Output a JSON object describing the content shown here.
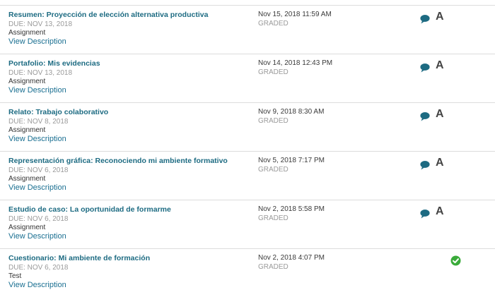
{
  "rows": [
    {
      "title": "Resumen: Proyección de elección alternativa productiva",
      "due": "DUE: NOV 13, 2018",
      "type": "Assignment",
      "view": "View Description",
      "date": "Nov 15, 2018 11:59 AM",
      "status": "GRADED",
      "grade": "A",
      "icon": "comment-icon"
    },
    {
      "title": "Portafolio: Mis evidencias",
      "due": "DUE: NOV 13, 2018",
      "type": "Assignment",
      "view": "View Description",
      "date": "Nov 14, 2018 12:43 PM",
      "status": "GRADED",
      "grade": "A",
      "icon": "comment-icon"
    },
    {
      "title": "Relato: Trabajo colaborativo",
      "due": "DUE: NOV 8, 2018",
      "type": "Assignment",
      "view": "View Description",
      "date": "Nov 9, 2018 8:30 AM",
      "status": "GRADED",
      "grade": "A",
      "icon": "comment-icon"
    },
    {
      "title": "Representación gráfica: Reconociendo mi ambiente formativo",
      "due": "DUE: NOV 6, 2018",
      "type": "Assignment",
      "view": "View Description",
      "date": "Nov 5, 2018 7:17 PM",
      "status": "GRADED",
      "grade": "A",
      "icon": "comment-icon"
    },
    {
      "title": "Estudio de caso: La oportunidad de formarme",
      "due": "DUE: NOV 6, 2018",
      "type": "Assignment",
      "view": "View Description",
      "date": "Nov 2, 2018 5:58 PM",
      "status": "GRADED",
      "grade": "A",
      "icon": "comment-icon"
    },
    {
      "title": "Cuestionario: Mi ambiente de formación",
      "due": "DUE: NOV 6, 2018",
      "type": "Test",
      "view": "View Description",
      "date": "Nov 2, 2018 4:07 PM",
      "status": "GRADED",
      "grade": "",
      "icon": "check-circle-icon"
    }
  ],
  "colors": {
    "title": "#1d6b82",
    "link": "#1a6f91",
    "muted": "#9a9a9a",
    "comment_icon": "#1d6b82",
    "check_icon": "#3aab3a"
  }
}
